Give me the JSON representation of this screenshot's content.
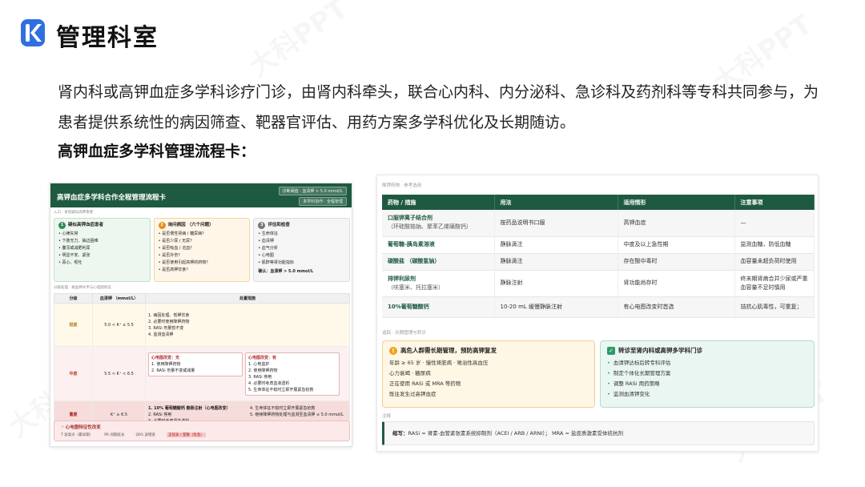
{
  "page": {
    "title": "管理科室",
    "intro": "肾内科或高钾血症多学科诊疗门诊，由肾内科牵头，联合心内科、内分泌科、急诊科及药剂科等专科共同参与，为患者提供系统性的病因筛查、靶器官评估、用药方案多学科优化及长期随访。",
    "subhead": "高钾血症多学科管理流程卡：",
    "watermark": "大科PPT"
  },
  "left_card": {
    "title": "高钾血症多学科合作全程管理流程卡",
    "badge1": "诊断阈值 · 血清钾 > 5.0 mmol/L",
    "badge2": "多学科协作 · 全程管理",
    "section1": "入口 · 发现疑似高钾患者",
    "steps": [
      {
        "num": "1",
        "title": "疑似高钾血症患者",
        "items": [
          "心律失常",
          "下肢无力、抽边困难",
          "腹泻或减肥利尿",
          "明显不安、紧张",
          "恶心、呕吐"
        ]
      },
      {
        "num": "2",
        "title": "询问病因 （六个问题）",
        "items": [
          "是否慢性肾病 / 糖尿病？",
          "是否少尿 / 无尿？",
          "是否吸血 / 溶血？",
          "是否外伤？",
          "是否使用引起高钾的药物？",
          "是否高钾饮食？"
        ]
      },
      {
        "num": "3",
        "title": "评估和检查",
        "items": [
          "生命体征",
          "血清钾",
          "血气分析",
          "心电图",
          "肌酐等肾功能指标"
        ],
        "confirm": "确认：血清钾 > 5.0 mmol/L"
      }
    ],
    "section2": "分级处理 · 按血钾水平与心电图状态",
    "table_headers": [
      "分级",
      "血清钾 （mmol/L）",
      "处置措施"
    ],
    "grades": [
      {
        "grade": "轻度",
        "range": "5.0 < K⁺ ≤ 5.5",
        "measures": [
          "1. 病因处理、低钾饮食",
          "2. 必要时使用降钾药物",
          "3. RASi 剂量暂不变",
          "4. 监测血清钾"
        ]
      },
      {
        "grade": "中度",
        "range": "5.5 < K⁺ < 6.5",
        "ecg_no_title": "心电图改变：无",
        "ecg_no": [
          "1. 使用降钾药物",
          "2. RASi 剂量不变或减量"
        ],
        "ecg_yes_title": "心电图改变：有",
        "ecg_yes": [
          "1. 心电监护",
          "2. 使用降钾药物",
          "3. RASi 停用",
          "4. 必要时考虑血液透析",
          "5. 生命体征不稳时立即开展紧急抢救"
        ]
      },
      {
        "grade": "重度",
        "range": "K⁺ ≥ 6.5",
        "measures_a": [
          "1. 10% 葡萄糖酸钙 静脉注射（心电图改变）",
          "2. RASi 停用",
          "3. 必要时考虑紧急透析"
        ],
        "measures_b": [
          "4. 生命体征不稳时立即开展紧急抢救",
          "5. 继续降钾药物处理与监测至血清钾 ≤ 5.0 mmol/L"
        ]
      }
    ],
    "ecg_title": "心电图特征性改变",
    "ecg_items": [
      "T 波高尖（最早期）",
      "PR 间期延长",
      "QRS 波增宽",
      "正弦波 / 室颤（危急）"
    ]
  },
  "right_card": {
    "section1": "降钾药物 · 参考选用",
    "headers": [
      "药物 / 措施",
      "用法",
      "适用情形",
      "注意事项"
    ],
    "rows": [
      {
        "name": "口服钾离子结合剂",
        "sub": "（环硅酸锆钠、聚苯乙烯磺酸钙）",
        "usage": "按药品说明书口服",
        "indication": "高钾血症",
        "note": "—"
      },
      {
        "name": "葡萄糖-胰岛素溶液",
        "sub": "",
        "usage": "静脉滴注",
        "indication": "中度及以上急性期",
        "note": "监测血糖，防低血糖"
      },
      {
        "name": "碳酸盐 （碳酸氢钠）",
        "sub": "",
        "usage": "静脉滴注",
        "indication": "存在酸中毒时",
        "note": "血容量未超负荷时使用"
      },
      {
        "name": "排钾利尿剂",
        "sub": "（呋塞米、托拉塞米）",
        "usage": "静脉注射",
        "indication": "肾功能尚存时",
        "note": "终末期肾病合并少尿或严重血容量不足时慎用"
      },
      {
        "name": "10%葡萄糖酸钙",
        "sub": "",
        "usage": "10-20 mL 缓慢静脉注射",
        "indication": "有心电图改变时首选",
        "note": "拮抗心肌毒性，可重复；"
      }
    ],
    "section2": "追踪 · 长期管理与转诊",
    "box_orange": {
      "title": "高危人群需长期管理，预防高钾复发",
      "lines": [
        "年龄 ≥ 65 岁 · 慢性肾脏病 · 难治性高血压",
        "心力衰竭 · 糖尿病",
        "正在使用 RASi 或 MRA 等药物",
        "既往发生过高钾血症"
      ]
    },
    "box_green": {
      "title": "转诊至肾内科或高钾多学科门诊",
      "items": [
        "血清钾达标后转专科评估",
        "制定个体化长期管理方案",
        "调整 RASi 用药策略",
        "监测血清钾变化"
      ]
    },
    "section3": "注释",
    "note_label": "缩写：",
    "note_text": "RASi = 肾素-血管紧张素系统抑制剂（ACEI / ARB / ARNI）； MRA = 盐皮质激素受体拮抗剂"
  },
  "colors": {
    "primary": "#1e5a40",
    "orange": "#f0a020",
    "green": "#2e9a6a",
    "danger": "#c0392b"
  }
}
